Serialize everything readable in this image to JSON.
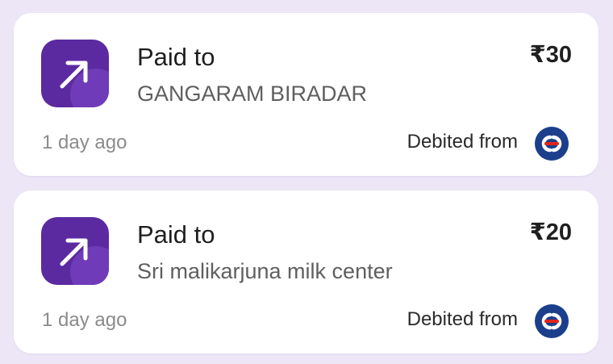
{
  "colors": {
    "background": "#ece6f7",
    "card": "#ffffff",
    "icon_bg": "#5b2aa0",
    "bank_blue": "#1c3f8c",
    "bank_red": "#e2231a"
  },
  "transactions": [
    {
      "direction_label": "Paid to",
      "payee": "GANGARAM BIRADAR",
      "amount": "₹30",
      "time": "1 day ago",
      "debited_label": "Debited from",
      "icon": "arrow-up-right-icon",
      "bank_icon": "kotak-bank-icon"
    },
    {
      "direction_label": "Paid to",
      "payee": "Sri malikarjuna milk center",
      "amount": "₹20",
      "time": "1 day ago",
      "debited_label": "Debited from",
      "icon": "arrow-up-right-icon",
      "bank_icon": "kotak-bank-icon"
    }
  ]
}
